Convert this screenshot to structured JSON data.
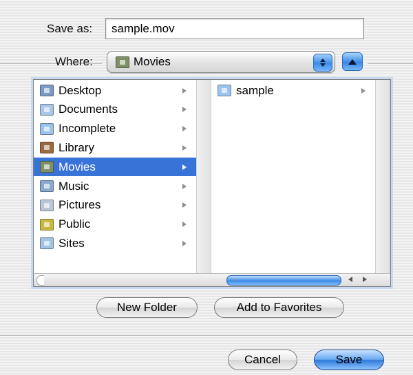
{
  "save_as": {
    "label": "Save as:",
    "value": "sample.mov"
  },
  "where": {
    "label": "Where:",
    "selected": "Movies"
  },
  "column1": {
    "items": [
      {
        "label": "Desktop",
        "icon": "desktop-folder-icon",
        "color": "#7d9ac4"
      },
      {
        "label": "Documents",
        "icon": "documents-folder-icon",
        "color": "#a9c6e8"
      },
      {
        "label": "Incomplete",
        "icon": "folder-icon",
        "color": "#9cc3ef"
      },
      {
        "label": "Library",
        "icon": "library-folder-icon",
        "color": "#9a6b42"
      },
      {
        "label": "Movies",
        "icon": "movies-folder-icon",
        "color": "#7f8f66",
        "selected": true
      },
      {
        "label": "Music",
        "icon": "music-folder-icon",
        "color": "#8aa8d0"
      },
      {
        "label": "Pictures",
        "icon": "pictures-folder-icon",
        "color": "#b9c6d6"
      },
      {
        "label": "Public",
        "icon": "public-folder-icon",
        "color": "#c7b93f"
      },
      {
        "label": "Sites",
        "icon": "sites-folder-icon",
        "color": "#a4c2e2"
      }
    ]
  },
  "column2": {
    "items": [
      {
        "label": "sample",
        "icon": "folder-icon",
        "color": "#9cc3ef"
      }
    ]
  },
  "buttons": {
    "new_folder": "New Folder",
    "add_favorites": "Add to Favorites",
    "cancel": "Cancel",
    "save": "Save"
  }
}
